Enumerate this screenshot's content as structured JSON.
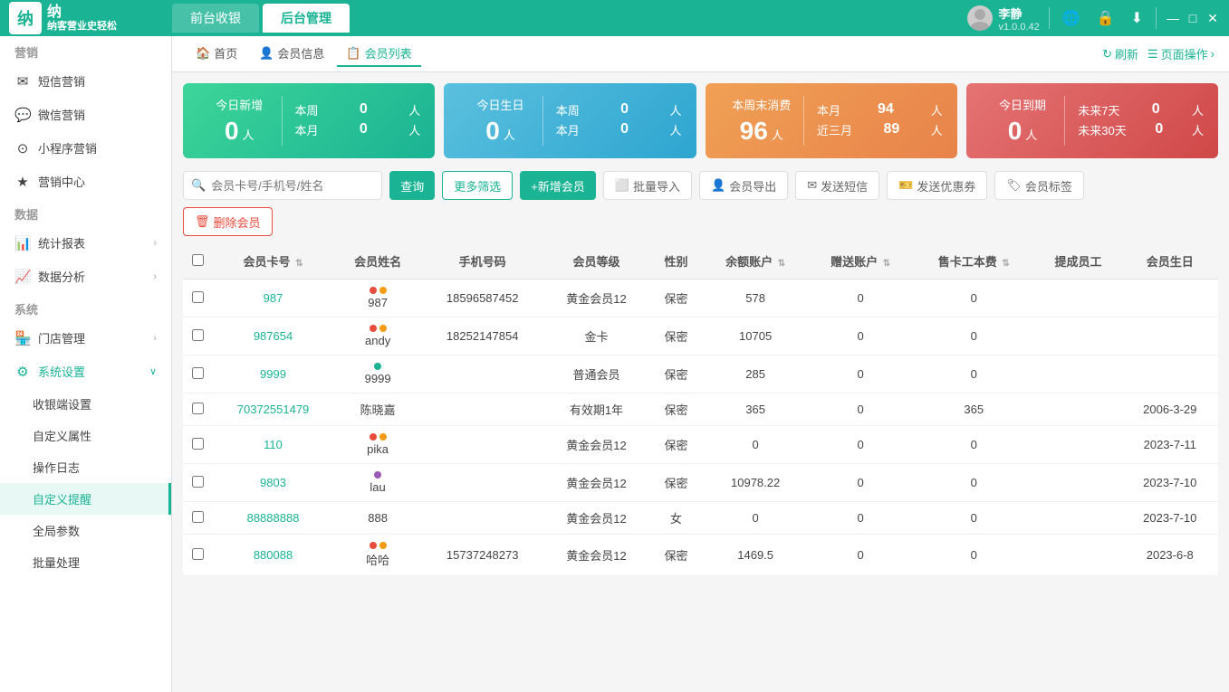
{
  "app": {
    "logo_char": "纳",
    "logo_sub": "纳客营业史轻松",
    "tab_front": "前台收银",
    "tab_back": "后台管理",
    "user_name": "李静",
    "user_version": "v1.0.0.42"
  },
  "nav": {
    "home": "首页",
    "member_info": "会员信息",
    "member_list": "会员列表",
    "refresh": "刷新",
    "page_ops": "页面操作"
  },
  "sidebar": {
    "section_marketing": "营销",
    "item_sms": "短信营销",
    "item_wechat": "微信营销",
    "item_miniapp": "小程序营销",
    "item_marketing_center": "营销中心",
    "section_data": "数据",
    "item_stats": "统计报表",
    "item_analysis": "数据分析",
    "section_system": "系统",
    "item_store": "门店管理",
    "item_settings": "系统设置",
    "sub_cashier": "收银端设置",
    "sub_custom_attr": "自定义属性",
    "sub_op_log": "操作日志",
    "sub_custom_remind": "自定义提醒",
    "sub_global_params": "全局参数",
    "sub_batch": "批量处理"
  },
  "stats": {
    "new_today_label": "今日新增",
    "new_today_value": "0",
    "new_today_unit": "人",
    "new_week_label": "本周",
    "new_week_value": "0",
    "new_week_unit": "人",
    "new_month_label": "本月",
    "new_month_value": "0",
    "new_month_unit": "人",
    "birthday_today_label": "今日生日",
    "birthday_today_value": "0",
    "birthday_today_unit": "人",
    "birthday_week_label": "本周",
    "birthday_week_value": "0",
    "birthday_week_unit": "人",
    "birthday_month_label": "本月",
    "birthday_month_value": "0",
    "birthday_month_unit": "人",
    "no_consume_label": "本周末消费",
    "no_consume_value": "96",
    "no_consume_unit": "人",
    "no_consume_month_label": "本月",
    "no_consume_month_value": "94",
    "no_consume_month_unit": "人",
    "no_consume_3month_label": "近三月",
    "no_consume_3month_value": "89",
    "no_consume_3month_unit": "人",
    "expire_today_label": "今日到期",
    "expire_today_value": "0",
    "expire_today_unit": "人",
    "expire_7_label": "未来7天",
    "expire_7_value": "0",
    "expire_7_unit": "人",
    "expire_30_label": "未来30天",
    "expire_30_value": "0",
    "expire_30_unit": "人"
  },
  "toolbar": {
    "search_placeholder": "会员卡号/手机号/姓名",
    "btn_search": "查询",
    "btn_more_filter": "更多筛选",
    "btn_add_member": "+新增会员",
    "btn_batch_import": "批量导入",
    "btn_export": "会员导出",
    "btn_send_sms": "发送短信",
    "btn_send_coupon": "发送优惠券",
    "btn_member_tag": "会员标签",
    "btn_delete": "删除会员"
  },
  "table": {
    "headers": [
      "会员卡号",
      "会员姓名",
      "手机号码",
      "会员等级",
      "性别",
      "余额账户",
      "赠送账户",
      "售卡工本费",
      "提成员工",
      "会员生日"
    ],
    "rows": [
      {
        "id": "987",
        "name": "987",
        "dots": [
          "red",
          "orange"
        ],
        "phone": "18596587452",
        "level": "黄金会员12",
        "gender": "保密",
        "balance": "578",
        "gift": "0",
        "card_cost": "0",
        "sales_staff": "",
        "birthday": ""
      },
      {
        "id": "987654",
        "name": "andy",
        "dots": [
          "red",
          "orange"
        ],
        "phone": "18252147854",
        "level": "金卡",
        "gender": "保密",
        "balance": "10705",
        "gift": "0",
        "card_cost": "0",
        "sales_staff": "",
        "birthday": ""
      },
      {
        "id": "9999",
        "name": "9999",
        "dots": [
          "green"
        ],
        "phone": "",
        "level": "普通会员",
        "gender": "保密",
        "balance": "285",
        "gift": "0",
        "card_cost": "0",
        "sales_staff": "",
        "birthday": ""
      },
      {
        "id": "70372551479",
        "name": "陈晓嘉",
        "dots": [],
        "phone": "",
        "level": "有效期1年",
        "gender": "保密",
        "balance": "365",
        "gift": "0",
        "card_cost": "365",
        "sales_staff": "",
        "birthday": "2006-3-29"
      },
      {
        "id": "110",
        "name": "pika",
        "dots": [
          "red",
          "orange"
        ],
        "phone": "",
        "level": "黄金会员12",
        "gender": "保密",
        "balance": "0",
        "gift": "0",
        "card_cost": "0",
        "sales_staff": "",
        "birthday": "2023-7-11"
      },
      {
        "id": "9803",
        "name": "lau",
        "dots": [
          "purple"
        ],
        "phone": "",
        "level": "黄金会员12",
        "gender": "保密",
        "balance": "10978.22",
        "gift": "0",
        "card_cost": "0",
        "sales_staff": "",
        "birthday": "2023-7-10"
      },
      {
        "id": "88888888",
        "name": "888",
        "dots": [],
        "phone": "",
        "level": "黄金会员12",
        "gender": "女",
        "balance": "0",
        "gift": "0",
        "card_cost": "0",
        "sales_staff": "",
        "birthday": "2023-7-10"
      },
      {
        "id": "880088",
        "name": "哈哈",
        "dots": [
          "red",
          "orange"
        ],
        "phone": "15737248273",
        "level": "黄金会员12",
        "gender": "保密",
        "balance": "1469.5",
        "gift": "0",
        "card_cost": "0",
        "sales_staff": "",
        "birthday": "2023-6-8"
      }
    ]
  },
  "colors": {
    "primary": "#1ab394",
    "dot_red": "#e74c3c",
    "dot_orange": "#f39c12",
    "dot_green": "#1ab394",
    "dot_purple": "#9b59b6"
  }
}
